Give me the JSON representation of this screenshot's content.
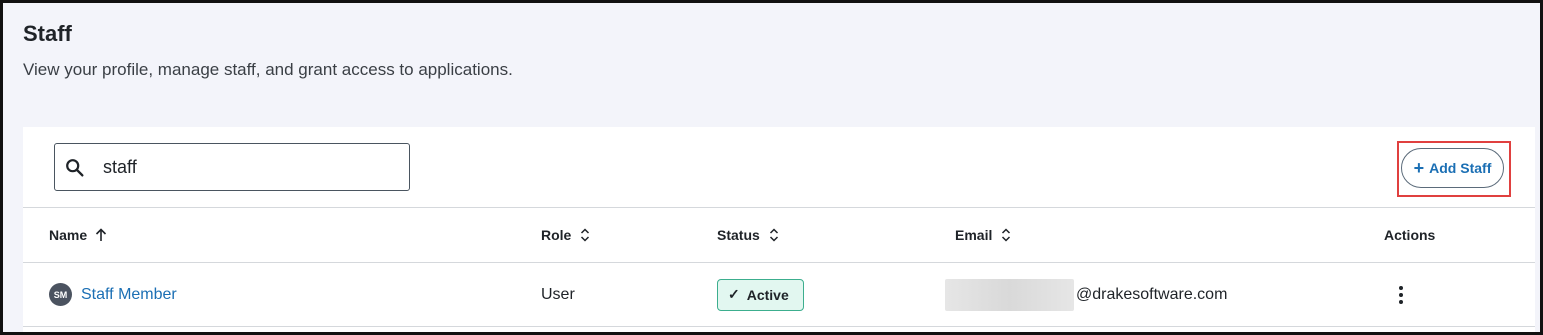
{
  "page": {
    "title": "Staff",
    "subtitle": "View your profile, manage staff, and grant access to applications."
  },
  "search": {
    "value": "staff",
    "icon": "search-icon"
  },
  "toolbar": {
    "add_staff_label": "Add Staff",
    "add_staff_icon": "plus-icon",
    "highlight_color": "#e0403f"
  },
  "table": {
    "columns": [
      {
        "label": "Name",
        "sort": "ascending"
      },
      {
        "label": "Role",
        "sort": "sortable"
      },
      {
        "label": "Status",
        "sort": "sortable"
      },
      {
        "label": "Email",
        "sort": "sortable"
      },
      {
        "label": "Actions",
        "sort": "none"
      }
    ],
    "rows": [
      {
        "avatar_initials": "SM",
        "name": "Staff Member",
        "role": "User",
        "status": "Active",
        "email_domain": "@drakesoftware.com",
        "email_redacted": true
      }
    ]
  },
  "colors": {
    "link": "#1b6fb4",
    "status_active_bg": "#e2f7f0",
    "status_active_border": "#3cae8e",
    "page_bg": "#f3f4fa"
  }
}
